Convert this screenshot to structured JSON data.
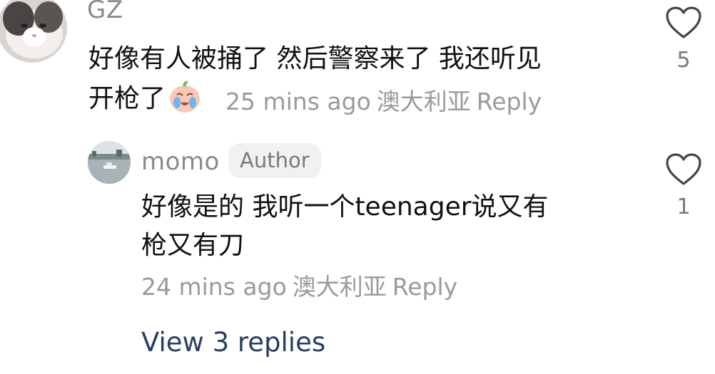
{
  "comment1": {
    "username": "GZ",
    "text_line1": "好像有人被捅了 然后警察来了 我还听见",
    "text_line2": "开枪了",
    "emoji": "crying-face-emoji",
    "time": "25 mins ago",
    "location": "澳大利亚",
    "reply": "Reply",
    "likes": "5"
  },
  "comment2": {
    "username": "momo",
    "badge": "Author",
    "text_line1": "好像是的 我听一个teenager说又有",
    "text_line2": "枪又有刀",
    "time": "24 mins ago",
    "location": "澳大利亚",
    "reply": "Reply",
    "likes": "1"
  },
  "view_replies": "View 3 replies",
  "colors": {
    "meta_gray": "#9a9a9a",
    "link_blue": "#2a3d62",
    "badge_bg": "#f1f1f1"
  }
}
